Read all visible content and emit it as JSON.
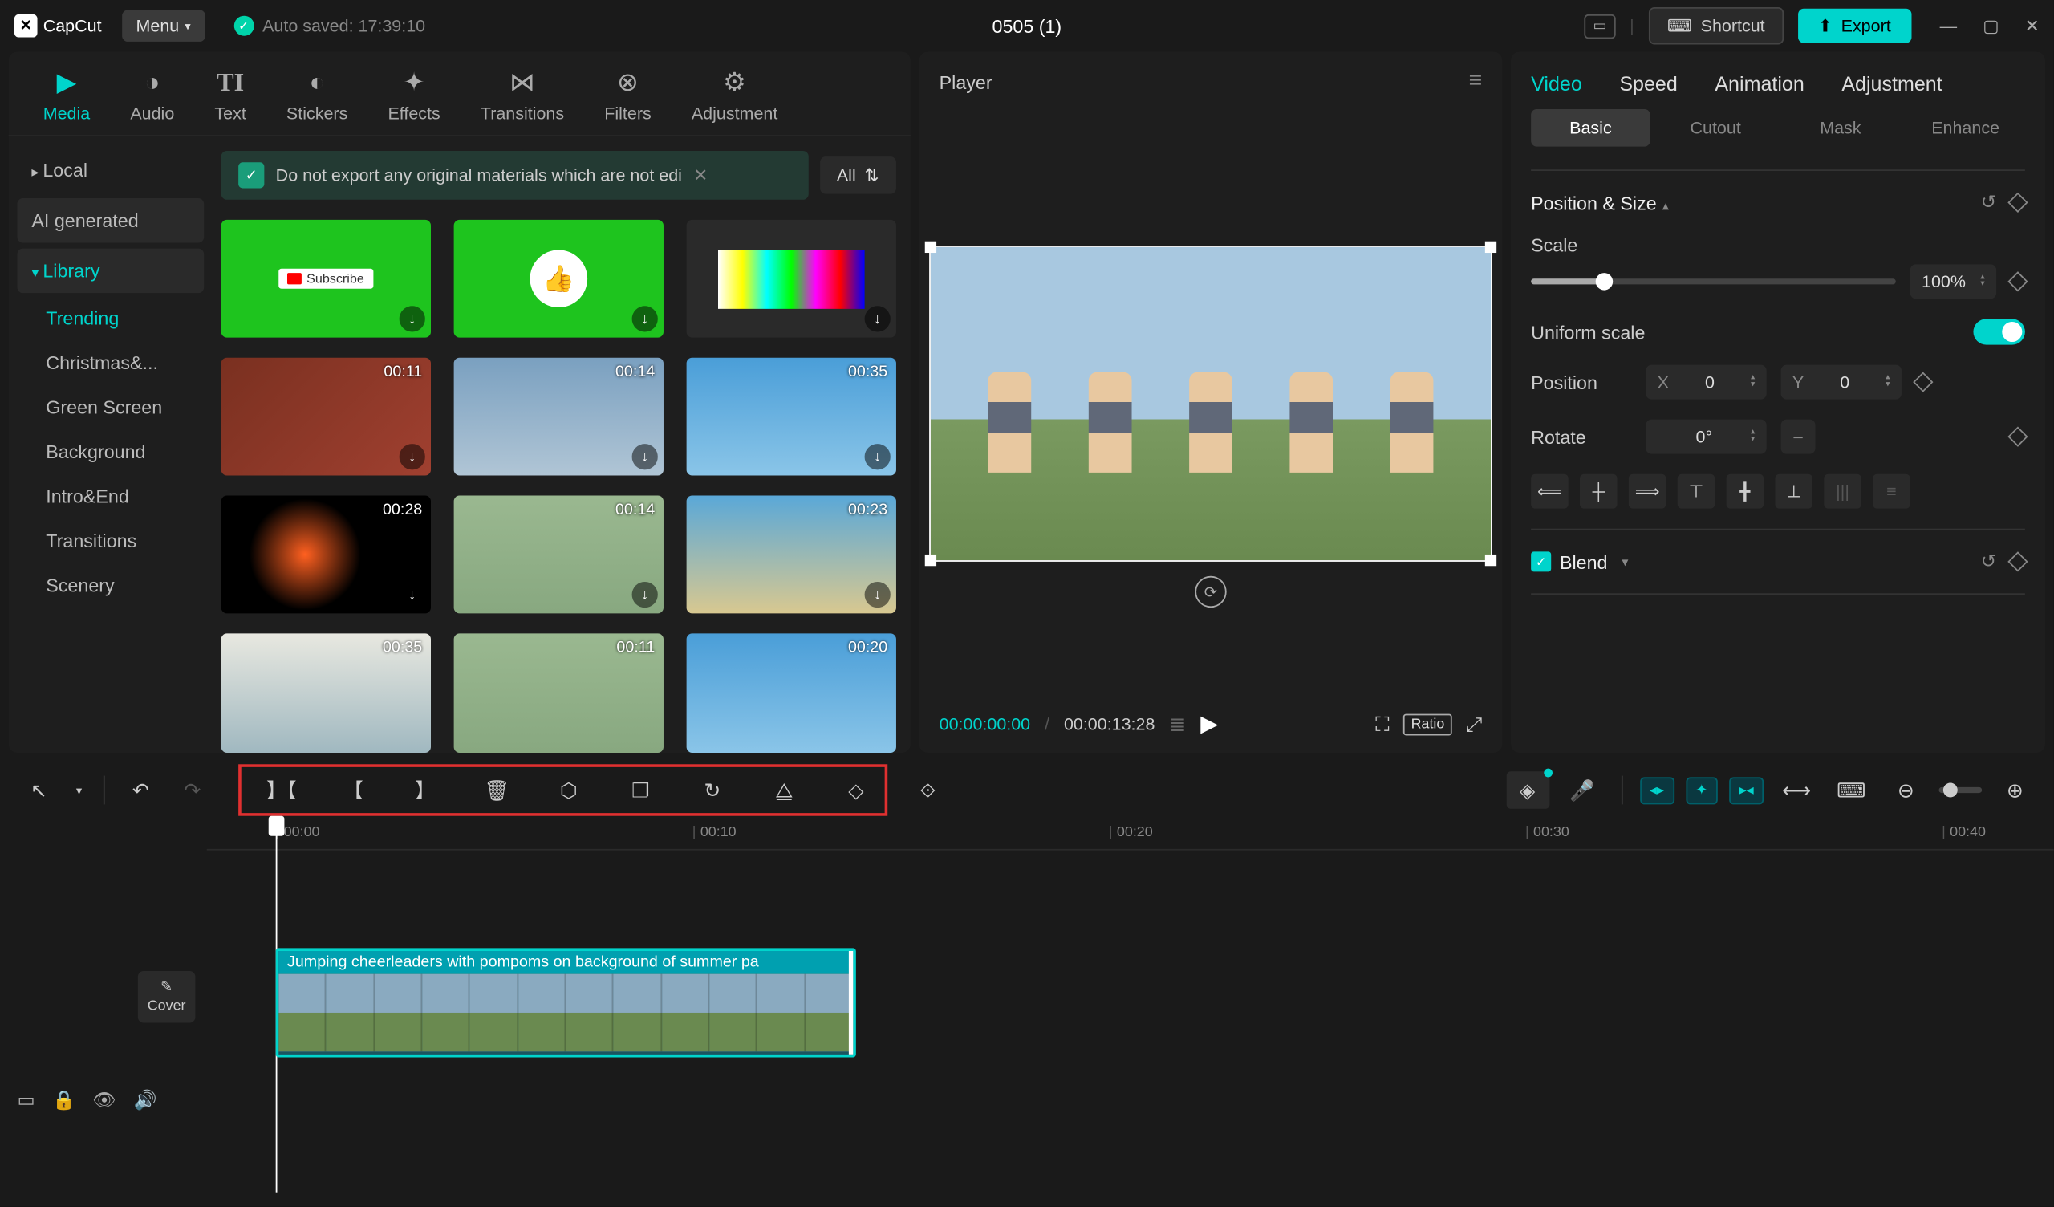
{
  "app_name": "CapCut",
  "menu_label": "Menu",
  "autosave_label": "Auto saved: 17:39:10",
  "project_title": "0505 (1)",
  "shortcut_label": "Shortcut",
  "export_label": "Export",
  "top_tabs": {
    "media": "Media",
    "audio": "Audio",
    "text": "Text",
    "stickers": "Stickers",
    "effects": "Effects",
    "transitions": "Transitions",
    "filters": "Filters",
    "adjustment": "Adjustment"
  },
  "sidebar": {
    "local": "Local",
    "ai": "AI generated",
    "library": "Library",
    "categories": {
      "trending": "Trending",
      "christmas": "Christmas&...",
      "greenscreen": "Green Screen",
      "background": "Background",
      "introend": "Intro&End",
      "transitions": "Transitions",
      "scenery": "Scenery"
    }
  },
  "banner_text": "Do not export any original materials which are not edi",
  "all_label": "All",
  "media_items": [
    {
      "duration": "",
      "type": "green",
      "subscribe": "Subscribe"
    },
    {
      "duration": "",
      "type": "green2"
    },
    {
      "duration": "",
      "type": "testcard"
    },
    {
      "duration": "00:11",
      "type": "xmas"
    },
    {
      "duration": "00:14",
      "type": "city"
    },
    {
      "duration": "00:35",
      "type": "beach"
    },
    {
      "duration": "00:28",
      "type": "fireworks"
    },
    {
      "duration": "00:14",
      "type": "cheer"
    },
    {
      "duration": "00:23",
      "type": "beach2"
    },
    {
      "duration": "00:35",
      "type": "coast"
    },
    {
      "duration": "00:11",
      "type": "cheer"
    },
    {
      "duration": "00:20",
      "type": "beach"
    }
  ],
  "player": {
    "title": "Player",
    "current_time": "00:00:00:00",
    "total_time": "00:00:13:28",
    "ratio": "Ratio"
  },
  "properties": {
    "tabs": {
      "video": "Video",
      "speed": "Speed",
      "animation": "Animation",
      "adjustment": "Adjustment"
    },
    "subtabs": {
      "basic": "Basic",
      "cutout": "Cutout",
      "mask": "Mask",
      "enhance": "Enhance"
    },
    "position_size": "Position & Size",
    "scale_label": "Scale",
    "scale_value": "100%",
    "uniform_label": "Uniform scale",
    "position_label": "Position",
    "pos_x_label": "X",
    "pos_x": "0",
    "pos_y_label": "Y",
    "pos_y": "0",
    "rotate_label": "Rotate",
    "rotate_value": "0°",
    "blend_label": "Blend"
  },
  "timeline": {
    "ticks": [
      "00:00",
      "00:10",
      "00:20",
      "00:30",
      "00:40"
    ],
    "clip_label": "Jumping cheerleaders with pompoms on background of summer pa",
    "cover": "Cover"
  }
}
